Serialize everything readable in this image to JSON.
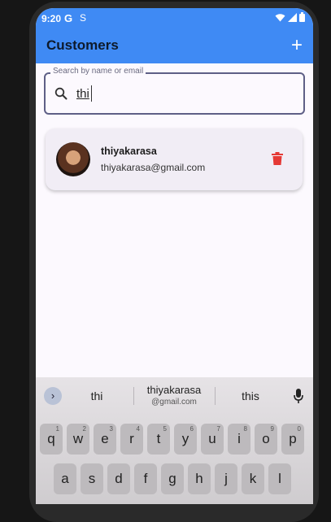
{
  "status_bar": {
    "time": "9:20",
    "g_icon": "G",
    "s_icon": "S"
  },
  "app_bar": {
    "title": "Customers",
    "add_label": "+"
  },
  "search": {
    "label": "Search by name or email",
    "value": "thi"
  },
  "customers": [
    {
      "name": "thiyakarasa",
      "email": "thiyakarasa@gmail.com"
    }
  ],
  "keyboard": {
    "suggestions": {
      "left": "thi",
      "middle_main": "thiyakarasa",
      "middle_sub": "@gmail.com",
      "right": "this"
    },
    "row1": [
      "q",
      "w",
      "e",
      "r",
      "t",
      "y",
      "u",
      "i",
      "o",
      "p"
    ],
    "row1_hints": [
      "1",
      "2",
      "3",
      "4",
      "5",
      "6",
      "7",
      "8",
      "9",
      "0"
    ],
    "row2": [
      "a",
      "s",
      "d",
      "f",
      "g",
      "h",
      "j",
      "k",
      "l"
    ],
    "expand_glyph": "›"
  },
  "colors": {
    "app_bar": "#3f8af4",
    "delete": "#e53935",
    "background": "#fcf9fe"
  }
}
